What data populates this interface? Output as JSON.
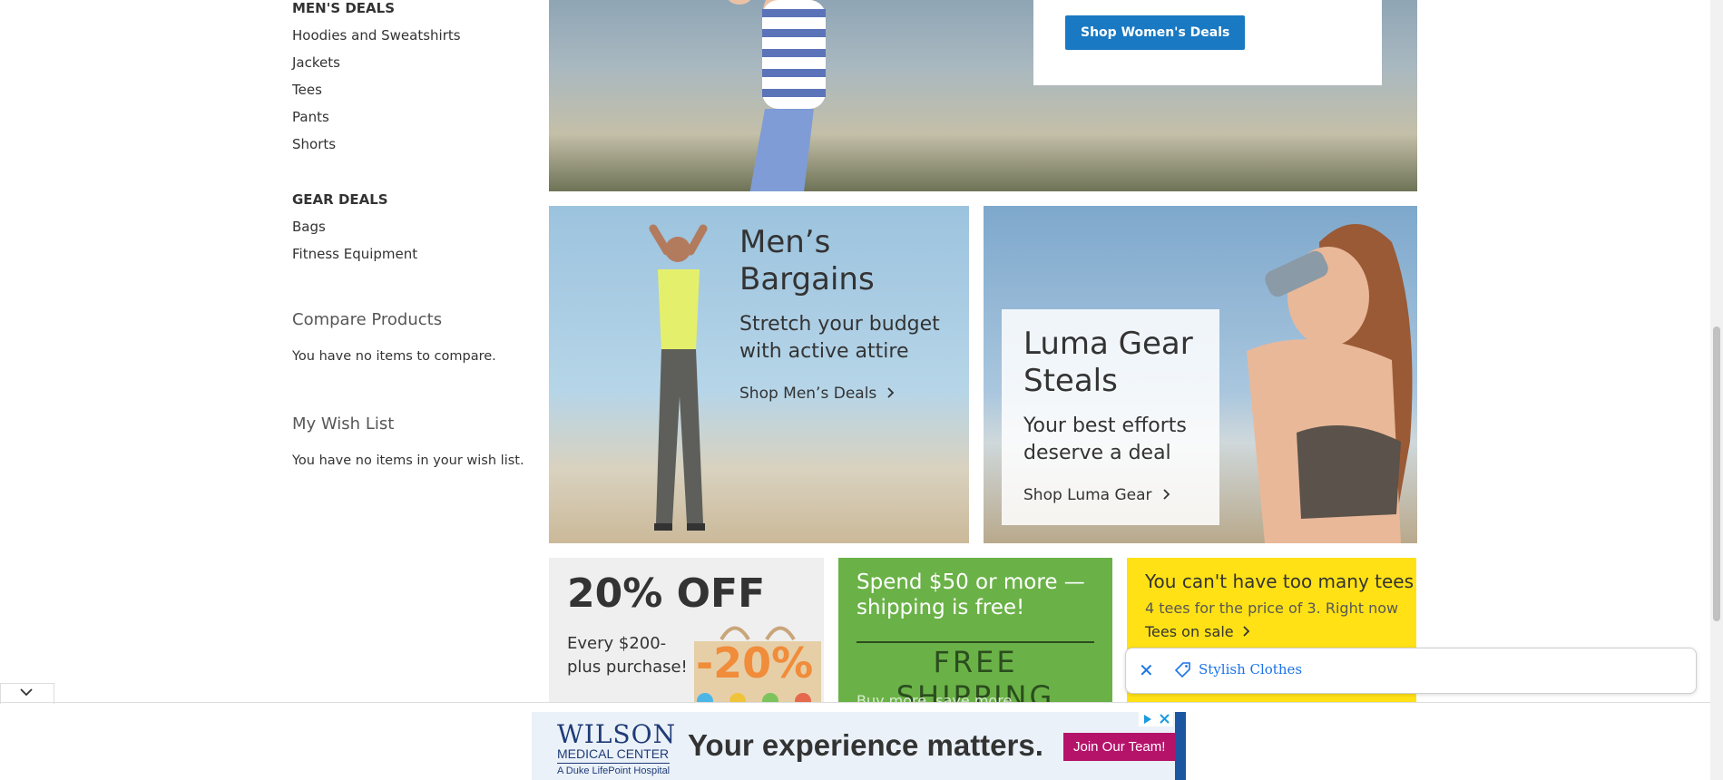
{
  "sidebar": {
    "mens_heading": "MEN'S DEALS",
    "mens_items": [
      "Hoodies and Sweatshirts",
      "Jackets",
      "Tees",
      "Pants",
      "Shorts"
    ],
    "gear_heading": "GEAR DEALS",
    "gear_items": [
      "Bags",
      "Fitness Equipment"
    ],
    "compare_title": "Compare Products",
    "compare_text": "You have no items to compare.",
    "wishlist_title": "My Wish List",
    "wishlist_text": "You have no items in your wish list."
  },
  "hero": {
    "button_label": "Shop Women's Deals"
  },
  "mens_tile": {
    "title": "Men’s Bargains",
    "subtitle": "Stretch your budget with active attire",
    "link": "Shop Men’s Deals"
  },
  "gear_tile": {
    "title": "Luma Gear Steals",
    "subtitle": "Your best efforts deserve a deal",
    "link": "Shop Luma Gear"
  },
  "promo_off": {
    "title": "20% OFF",
    "subtitle": "Every $200-plus purchase!",
    "graphic_text": "-20%"
  },
  "promo_ship": {
    "title": "Spend $50 or more — shipping is free!",
    "banner": "FREE SHIPPING",
    "subtitle": "Buy more, save more"
  },
  "promo_tees": {
    "title": "You can't have too many tees",
    "subtitle": "4 tees for the price of 3. Right now",
    "link": "Tees on sale"
  },
  "search_chip": {
    "label": "Stylish Clothes"
  },
  "ad": {
    "logo_line1": "WILSON",
    "logo_line2": "MEDICAL CENTER",
    "logo_line3": "A Duke LifePoint Hospital",
    "tagline": "Your experience matters.",
    "button": "Join Our Team!"
  },
  "colors": {
    "primary_button": "#1979c3",
    "ship_green": "#6ab247",
    "tees_yellow": "#ffe115",
    "ad_button": "#b5126a"
  },
  "icons": {
    "chip_close": "close-icon",
    "chip_tag": "tag-icon",
    "collapse": "chevron-down-icon",
    "link_arrow": "chevron-right-icon"
  }
}
